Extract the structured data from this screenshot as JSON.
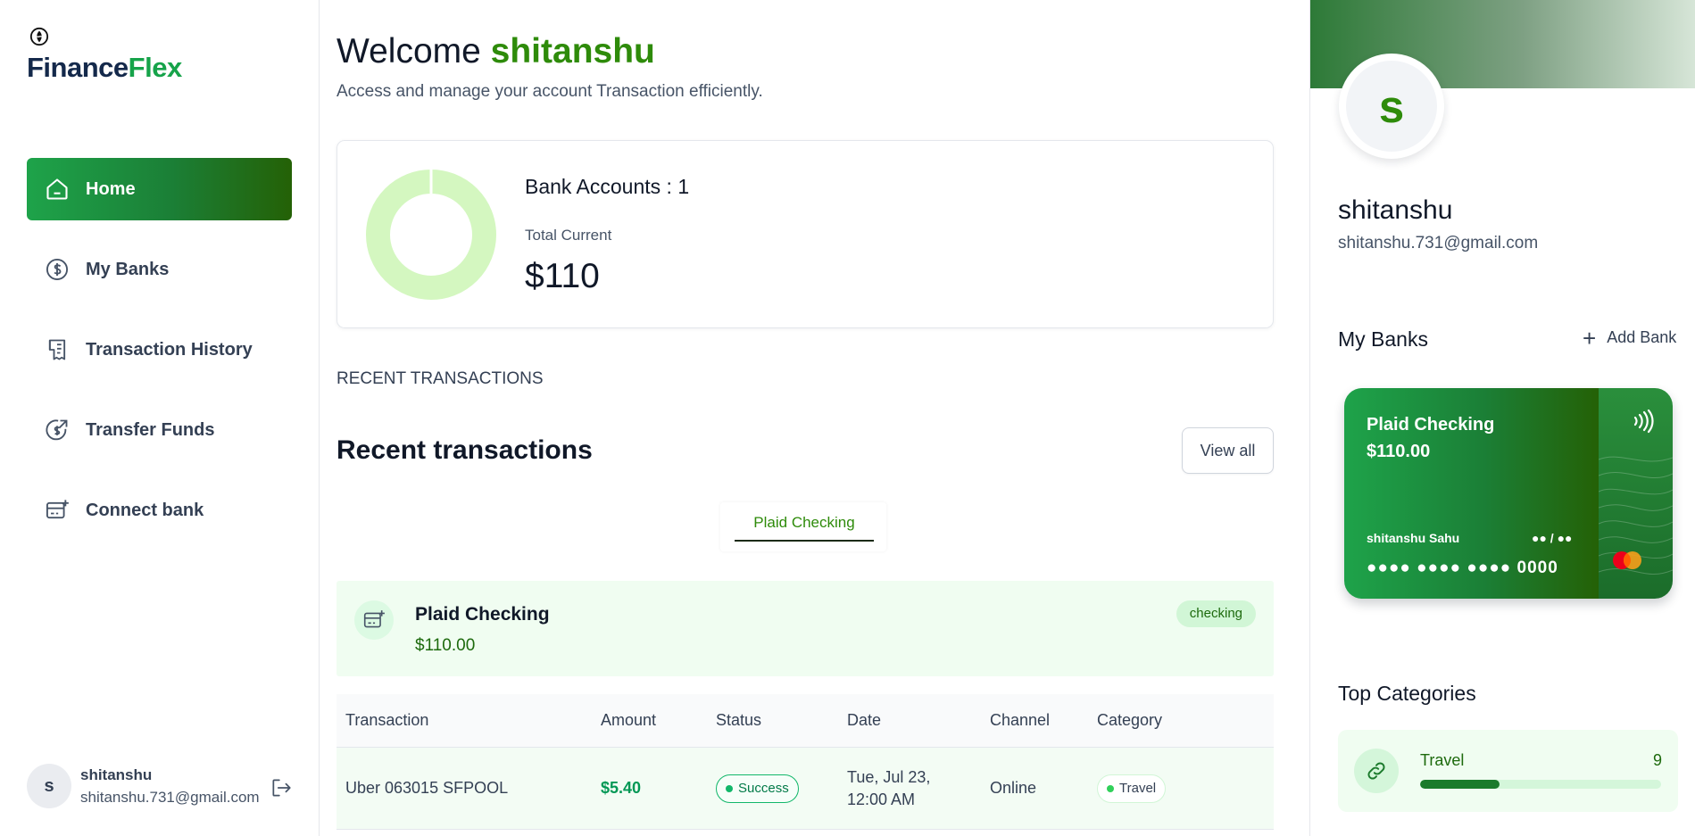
{
  "brand": {
    "part1": "Finance",
    "part2": "Flex"
  },
  "sidebar": {
    "items": [
      {
        "label": "Home",
        "icon": "home-icon",
        "active": true
      },
      {
        "label": "My Banks",
        "icon": "dollar-circle-icon"
      },
      {
        "label": "Transaction History",
        "icon": "receipt-icon"
      },
      {
        "label": "Transfer Funds",
        "icon": "transfer-icon"
      },
      {
        "label": "Connect bank",
        "icon": "card-plus-icon"
      }
    ],
    "user": {
      "initial": "s",
      "name": "shitanshu",
      "email": "shitanshu.731@gmail.com"
    }
  },
  "header": {
    "welcome": "Welcome",
    "user_name": "shitanshu",
    "subtitle": "Access and manage your account Transaction efficiently."
  },
  "balance": {
    "bank_accounts_text": "Bank Accounts : 1",
    "total_label": "Total Current",
    "total_value": "$110",
    "donut_fill": 1.0,
    "donut_color": "#d4f7c0"
  },
  "recent": {
    "caps_heading": "RECENT TRANSACTIONS",
    "title": "Recent transactions",
    "view_all": "View all",
    "tab_label": "Plaid Checking",
    "account": {
      "name": "Plaid Checking",
      "balance": "$110.00",
      "type": "checking"
    },
    "columns": [
      "Transaction",
      "Amount",
      "Status",
      "Date",
      "Channel",
      "Category"
    ],
    "rows": [
      {
        "name": "Uber 063015 SFPOOL",
        "amount": "$5.40",
        "status": "Success",
        "date_line1": "Tue, Jul 23,",
        "date_line2": "12:00 AM",
        "channel": "Online",
        "category": "Travel"
      }
    ]
  },
  "profile": {
    "initial": "s",
    "name": "shitanshu",
    "email": "shitanshu.731@gmail.com"
  },
  "banks": {
    "title": "My Banks",
    "add_label": "Add Bank",
    "card": {
      "name": "Plaid Checking",
      "balance": "$110.00",
      "holder": "shitanshu Sahu",
      "expiry": "●● / ●●",
      "number": "●●●● ●●●● ●●●● 0000"
    }
  },
  "categories": {
    "title": "Top Categories",
    "items": [
      {
        "name": "Travel",
        "count": "9",
        "fill": 0.33
      }
    ]
  },
  "colors": {
    "brand_green": "#16a34a",
    "accent_dark_green": "#246106",
    "name_green": "#2e8b0a"
  }
}
